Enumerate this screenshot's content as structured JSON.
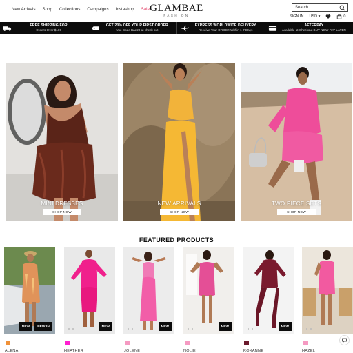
{
  "header": {
    "nav": [
      "New Arrivals",
      "Shop",
      "Collections",
      "Campaigns",
      "Instashop",
      "Sale"
    ],
    "logo": "GLAMBAE",
    "logo_sub": "FASHION",
    "search_placeholder": "Search",
    "sign_in": "SIGN IN",
    "currency": "USD",
    "cart_count": "0",
    "sale_color": "#e0315b"
  },
  "promo": [
    {
      "icon": "truck-icon",
      "title": "FREE SHIPPING FOR",
      "subtitle": "Orders Over $100"
    },
    {
      "icon": "tag-icon",
      "title": "GET 20% OFF YOUR FIRST ORDER",
      "subtitle": "Use Code Bae20 at check out"
    },
    {
      "icon": "plane-icon",
      "title": "EXPRESS WORLDWIDE DELIVERY",
      "subtitle": "Receive Your ORDER Within 1-7 Days"
    },
    {
      "icon": "card-icon",
      "title": "AFTERPAY",
      "subtitle": "Available at Checkout BUY NOW PAY LATER"
    }
  ],
  "hero": [
    {
      "caption": "MINI DRESSES",
      "button": "SHOP NOW"
    },
    {
      "caption": "NEW ARRIVALS",
      "button": "SHOP NOW"
    },
    {
      "caption": "TWO PIECE SETS",
      "button": "SHOP NOW"
    }
  ],
  "featured": {
    "title": "FEATURED PRODUCTS",
    "products": [
      {
        "name": "ALENA",
        "swatch": "#f0923a",
        "badges": [
          "NEW",
          "NEW IN"
        ]
      },
      {
        "name": "HEATHER",
        "swatch": "#ff1fd0",
        "badges": [
          "NEW"
        ]
      },
      {
        "name": "JOLENE",
        "swatch": "#f59ac2",
        "badges": [
          "NEW"
        ]
      },
      {
        "name": "NOLIE",
        "swatch": "#f59ac2",
        "badges": [
          "NEW"
        ]
      },
      {
        "name": "ROXANNE",
        "swatch": "#6b1a2c",
        "badges": [
          "NEW"
        ]
      },
      {
        "name": "HAZEL",
        "swatch": "#f59ac2",
        "badges": []
      }
    ]
  }
}
